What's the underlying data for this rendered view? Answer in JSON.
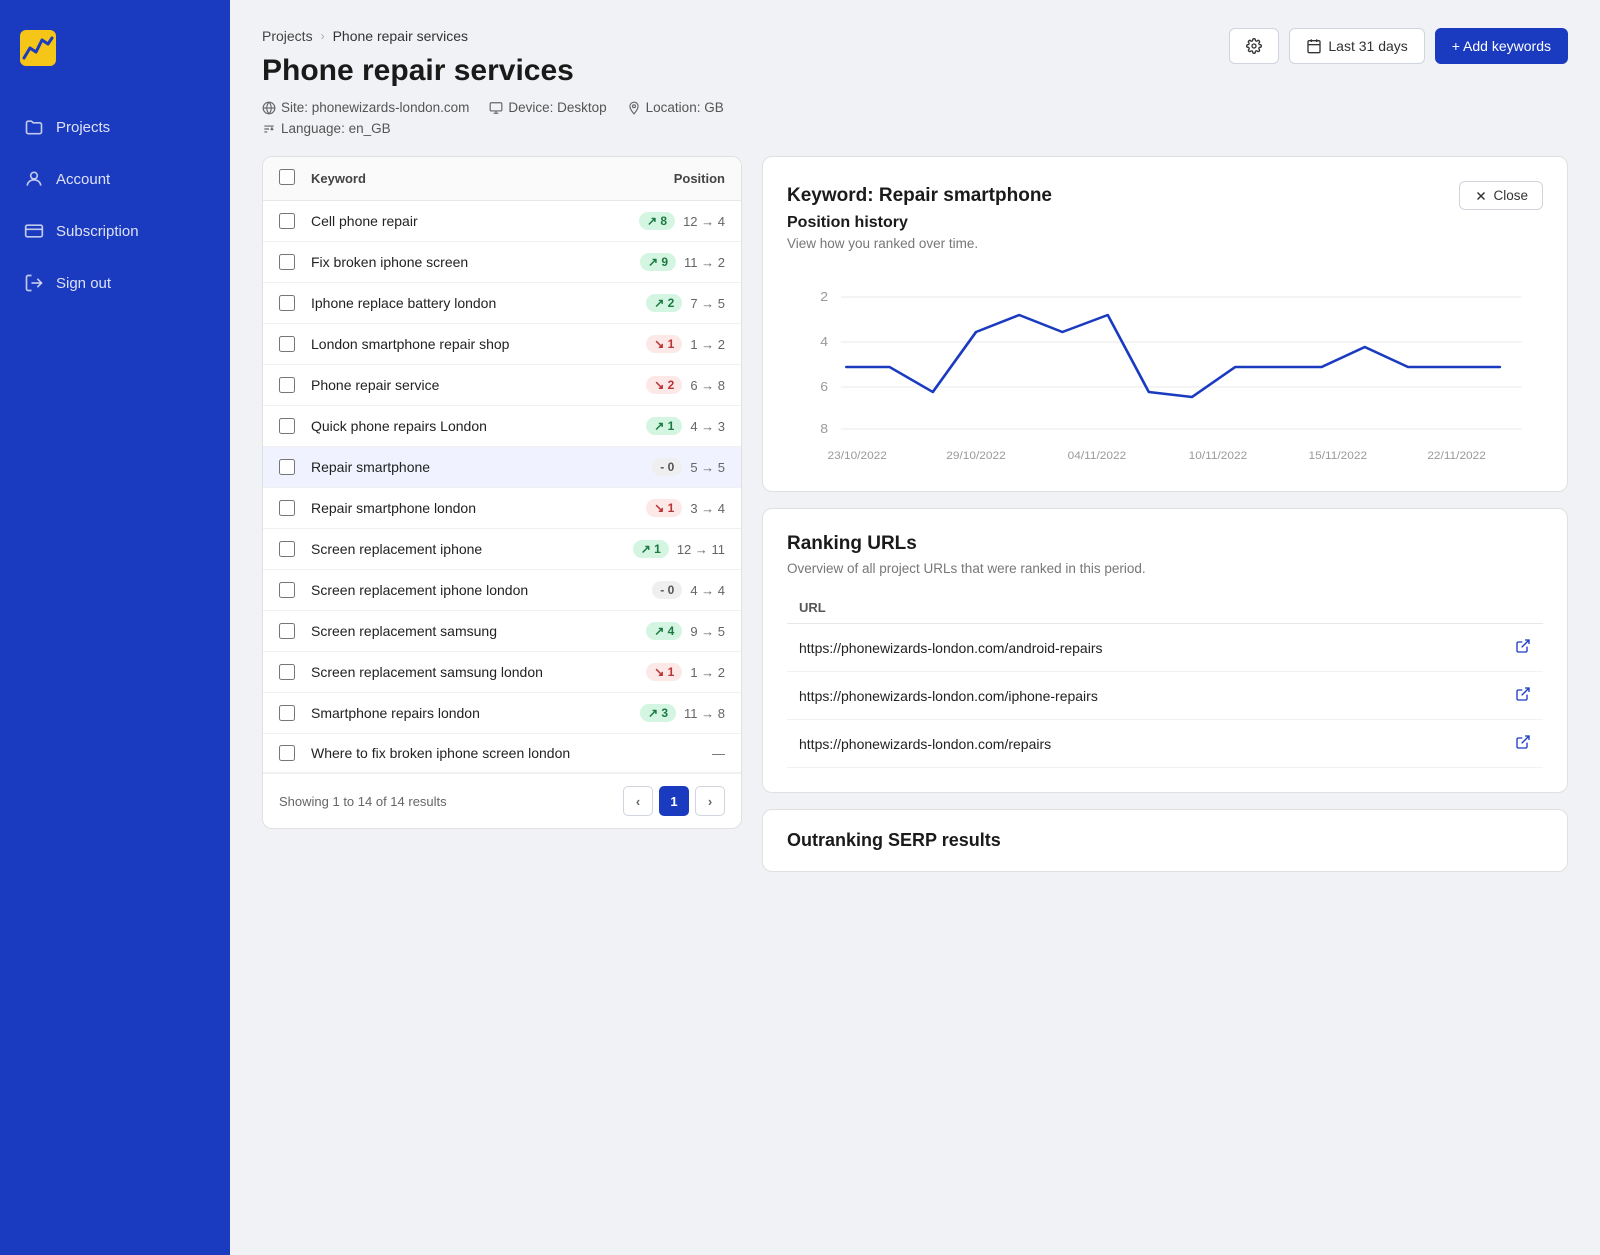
{
  "sidebar": {
    "logo_label": "Analytics Logo",
    "items": [
      {
        "id": "projects",
        "label": "Projects",
        "icon": "folder-icon"
      },
      {
        "id": "account",
        "label": "Account",
        "icon": "person-icon"
      },
      {
        "id": "subscription",
        "label": "Subscription",
        "icon": "card-icon"
      },
      {
        "id": "signout",
        "label": "Sign out",
        "icon": "logout-icon"
      }
    ]
  },
  "breadcrumb": {
    "parent": "Projects",
    "current": "Phone repair services"
  },
  "page": {
    "title": "Phone repair services",
    "site": "Site: phonewizards-london.com",
    "device": "Device: Desktop",
    "location": "Location: GB",
    "language": "Language: en_GB"
  },
  "header_actions": {
    "settings_label": "",
    "date_range": "Last 31 days",
    "add_keywords": "+ Add keywords"
  },
  "table": {
    "col_keyword": "Keyword",
    "col_position": "Position",
    "footer": "Showing 1 to 14 of 14 results",
    "rows": [
      {
        "keyword": "Cell phone repair",
        "badge": "↗ 8",
        "badge_type": "green",
        "from": "12",
        "to": "4"
      },
      {
        "keyword": "Fix broken iphone screen",
        "badge": "↗ 9",
        "badge_type": "green",
        "from": "11",
        "to": "2"
      },
      {
        "keyword": "Iphone replace battery london",
        "badge": "↗ 2",
        "badge_type": "green",
        "from": "7",
        "to": "5"
      },
      {
        "keyword": "London smartphone repair shop",
        "badge": "↘ 1",
        "badge_type": "red",
        "from": "1",
        "to": "2"
      },
      {
        "keyword": "Phone repair service",
        "badge": "↘ 2",
        "badge_type": "red",
        "from": "6",
        "to": "8"
      },
      {
        "keyword": "Quick phone repairs London",
        "badge": "↗ 1",
        "badge_type": "green",
        "from": "4",
        "to": "3"
      },
      {
        "keyword": "Repair smartphone",
        "badge": "- 0",
        "badge_type": "neutral",
        "from": "5",
        "to": "5"
      },
      {
        "keyword": "Repair smartphone london",
        "badge": "↘ 1",
        "badge_type": "red",
        "from": "3",
        "to": "4"
      },
      {
        "keyword": "Screen replacement iphone",
        "badge": "↗ 1",
        "badge_type": "green",
        "from": "12",
        "to": "11"
      },
      {
        "keyword": "Screen replacement iphone london",
        "badge": "- 0",
        "badge_type": "neutral",
        "from": "4",
        "to": "4"
      },
      {
        "keyword": "Screen replacement samsung",
        "badge": "↗ 4",
        "badge_type": "green",
        "from": "9",
        "to": "5"
      },
      {
        "keyword": "Screen replacement samsung london",
        "badge": "↘ 1",
        "badge_type": "red",
        "from": "1",
        "to": "2"
      },
      {
        "keyword": "Smartphone repairs london",
        "badge": "↗ 3",
        "badge_type": "green",
        "from": "11",
        "to": "8"
      },
      {
        "keyword": "Where to fix broken iphone screen london",
        "badge": "-",
        "badge_type": "neutral",
        "from": "",
        "to": ""
      }
    ],
    "pagination": {
      "showing": "Showing 1 to 14 of 14 results",
      "current_page": 1
    }
  },
  "keyword_panel": {
    "title": "Keyword: Repair smartphone",
    "close_label": "Close",
    "position_history_title": "Position history",
    "position_history_subtitle": "View how you ranked over time.",
    "chart": {
      "dates": [
        "23/10/2022",
        "29/10/2022",
        "04/11/2022",
        "10/11/2022",
        "15/11/2022",
        "22/11/2022"
      ],
      "y_labels": [
        "2",
        "4",
        "6",
        "8"
      ],
      "points": [
        {
          "x": 0.03,
          "y": 0.72
        },
        {
          "x": 0.12,
          "y": 0.72
        },
        {
          "x": 0.22,
          "y": 0.88
        },
        {
          "x": 0.3,
          "y": 0.52
        },
        {
          "x": 0.36,
          "y": 0.4
        },
        {
          "x": 0.43,
          "y": 0.52
        },
        {
          "x": 0.5,
          "y": 0.4
        },
        {
          "x": 0.57,
          "y": 0.88
        },
        {
          "x": 0.62,
          "y": 0.9
        },
        {
          "x": 0.68,
          "y": 0.72
        },
        {
          "x": 0.74,
          "y": 0.72
        },
        {
          "x": 0.8,
          "y": 0.72
        },
        {
          "x": 0.86,
          "y": 0.6
        },
        {
          "x": 0.92,
          "y": 0.72
        },
        {
          "x": 0.97,
          "y": 0.72
        }
      ]
    }
  },
  "ranking_urls": {
    "title": "Ranking URLs",
    "subtitle": "Overview of all project URLs that were ranked in this period.",
    "col_url": "URL",
    "urls": [
      "https://phonewizards-london.com/android-repairs",
      "https://phonewizards-london.com/iphone-repairs",
      "https://phonewizards-london.com/repairs"
    ]
  },
  "outranking": {
    "title": "Outranking SERP results"
  }
}
